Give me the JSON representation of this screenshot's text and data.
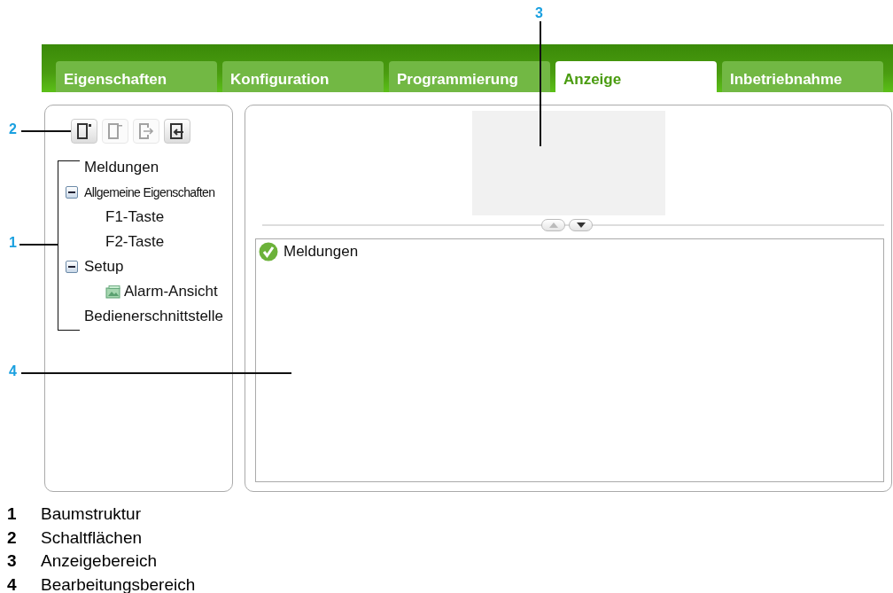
{
  "tabs": [
    {
      "label": "Eigenschaften",
      "selected": false
    },
    {
      "label": "Konfiguration",
      "selected": false
    },
    {
      "label": "Programmierung",
      "selected": false
    },
    {
      "label": "Anzeige",
      "selected": true
    },
    {
      "label": "Inbetriebnahme",
      "selected": false
    }
  ],
  "toolbar": [
    {
      "kind": "new",
      "disabled": false
    },
    {
      "kind": "remove",
      "disabled": true
    },
    {
      "kind": "export",
      "disabled": true
    },
    {
      "kind": "import",
      "disabled": false
    }
  ],
  "tree": [
    {
      "label": "Meldungen"
    },
    {
      "label": "Allgemeine Eigenschaften",
      "expanded": true,
      "children": [
        {
          "label": "F1-Taste"
        },
        {
          "label": "F2-Taste"
        }
      ]
    },
    {
      "label": "Setup",
      "expanded": true,
      "children": [
        {
          "label": "Alarm-Ansicht",
          "kind": "screen"
        }
      ]
    },
    {
      "label": "Bedienerschnittstelle"
    }
  ],
  "splitter": [
    {
      "kind": "up",
      "disabled": true
    },
    {
      "kind": "down",
      "disabled": false
    }
  ],
  "editor": {
    "items": [
      {
        "label": "Meldungen",
        "kind": "ok"
      }
    ]
  },
  "callouts": [
    {
      "number": "3"
    },
    {
      "number": "2"
    },
    {
      "number": "1"
    },
    {
      "number": "4"
    }
  ],
  "legend": [
    {
      "number": "1",
      "text": "Baumstruktur"
    },
    {
      "number": "2",
      "text": "Schaltflächen"
    },
    {
      "number": "3",
      "text": "Anzeigebereich"
    },
    {
      "number": "4",
      "text": "Bearbeitungsbereich"
    }
  ]
}
